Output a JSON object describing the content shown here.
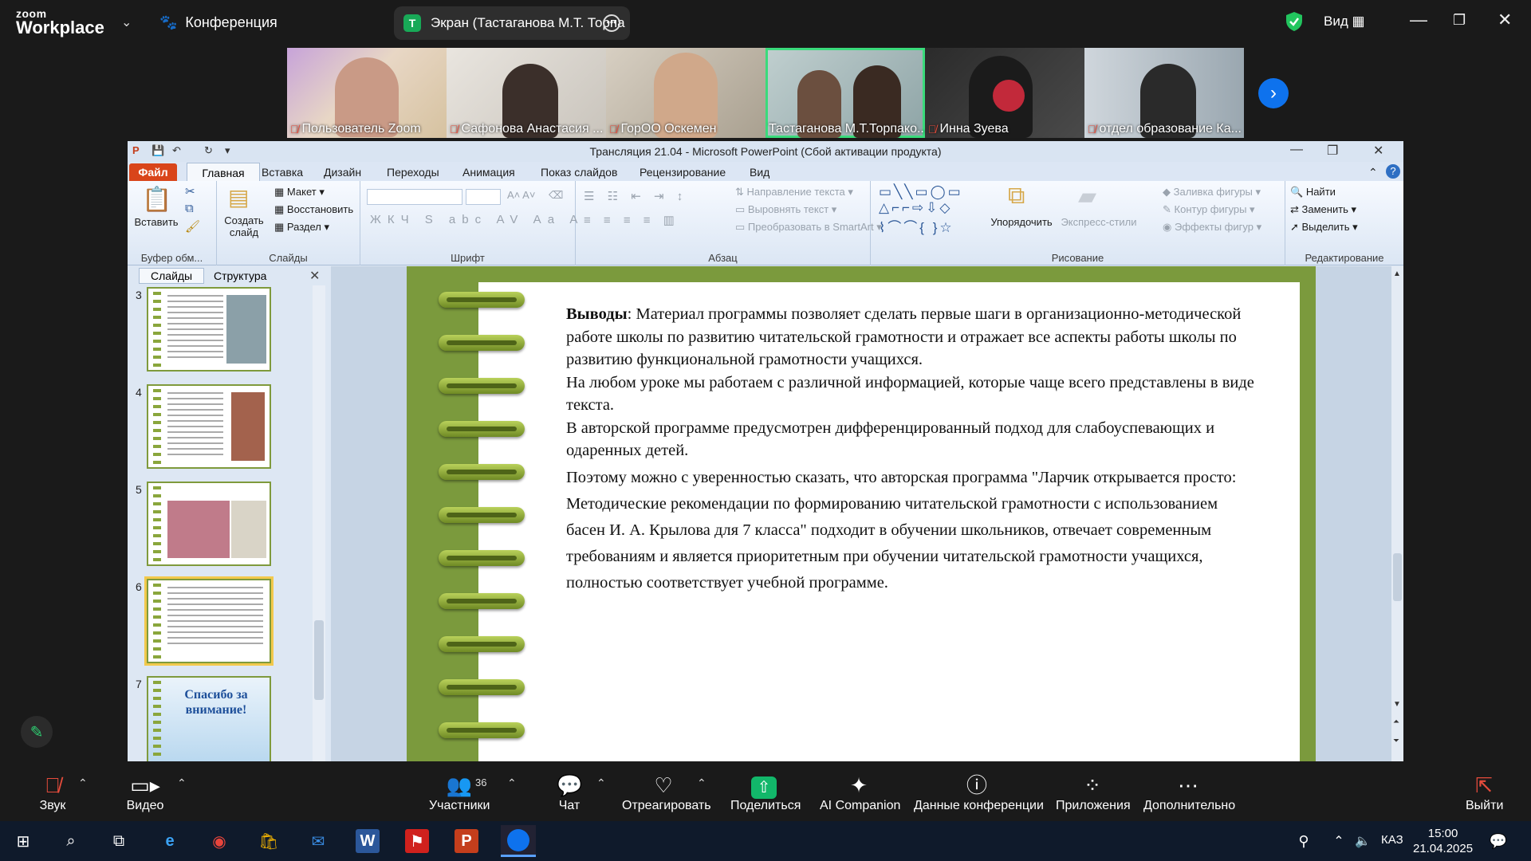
{
  "zoom": {
    "brand_top": "zoom",
    "brand_bottom": "Workplace",
    "meeting_label": "Конференция",
    "share_title": "Экран (Тастаганова М.Т. Торпа",
    "share_badge": "T",
    "view_label": "Вид"
  },
  "participants": [
    {
      "name": "Пользователь Zoom"
    },
    {
      "name": "Сафонова Анастасия ..."
    },
    {
      "name": "ГорОО Оскемен"
    },
    {
      "name": "Тастаганова М.Т.Торпако..."
    },
    {
      "name": "Инна Зуева"
    },
    {
      "name": "отдел образование Ка..."
    }
  ],
  "pp": {
    "title": "Трансляция 21.04 - Microsoft PowerPoint (Сбой активации продукта)",
    "file_tab": "Файл",
    "tabs": [
      "Главная",
      "Вставка",
      "Дизайн",
      "Переходы",
      "Анимация",
      "Показ слайдов",
      "Рецензирование",
      "Вид"
    ],
    "ribbon": {
      "paste": "Вставить",
      "clipboard": "Буфер обм...",
      "new_slide": "Создать слайд",
      "layout": "Макет",
      "reset": "Восстановить",
      "section": "Раздел",
      "slides": "Слайды",
      "font": "Шрифт",
      "text_dir": "Направление текста",
      "align_text": "Выровнять текст",
      "smartart": "Преобразовать в SmartArt",
      "paragraph": "Абзац",
      "arrange": "Упорядочить",
      "quick_styles": "Экспресс-стили",
      "shape_fill": "Заливка фигуры",
      "shape_outline": "Контур фигуры",
      "shape_effects": "Эффекты фигур",
      "drawing": "Рисование",
      "find": "Найти",
      "replace": "Заменить",
      "select": "Выделить",
      "editing": "Редактирование"
    },
    "pane_tabs": [
      "Слайды",
      "Структура"
    ],
    "thumbs": [
      {
        "num": "3"
      },
      {
        "num": "4"
      },
      {
        "num": "5"
      },
      {
        "num": "6"
      },
      {
        "num": "7",
        "text": "Спасибо за внимание!"
      }
    ],
    "slide": {
      "bold": "Выводы",
      "p1": ": Материал программы позволяет сделать первые шаги в организационно-методической работе школы по развитию читательской грамотности и отражает все аспекты работы школы по развитию функциональной грамотности учащихся.",
      "p2": "На любом уроке мы работаем с различной информацией, которые чаще всего представлены в виде текста.",
      "p3": "В авторской программе предусмотрен дифференцированный подход для слабоуспевающих  и одаренных детей.",
      "p4": "Поэтому можно с уверенностью сказать, что авторская программа \"Ларчик открывается просто: Методические рекомендации по формированию читательской грамотности с использованием басен И. А. Крылова для 7 класса\"   подходит  в обучении школьников, отвечает современным требованиям и является приоритетным при обучении читательской грамотности учащихся,  полностью соответствует учебной программе."
    }
  },
  "toolbar": {
    "audio": "Звук",
    "video": "Видео",
    "participants": "Участники",
    "participants_count": "36",
    "chat": "Чат",
    "react": "Отреагировать",
    "share": "Поделиться",
    "ai": "AI Companion",
    "meeting_info": "Данные конференции",
    "apps": "Приложения",
    "more": "Дополнительно",
    "leave": "Выйти"
  },
  "taskbar": {
    "lang": "КАЗ",
    "time": "15:00",
    "date": "21.04.2025"
  }
}
